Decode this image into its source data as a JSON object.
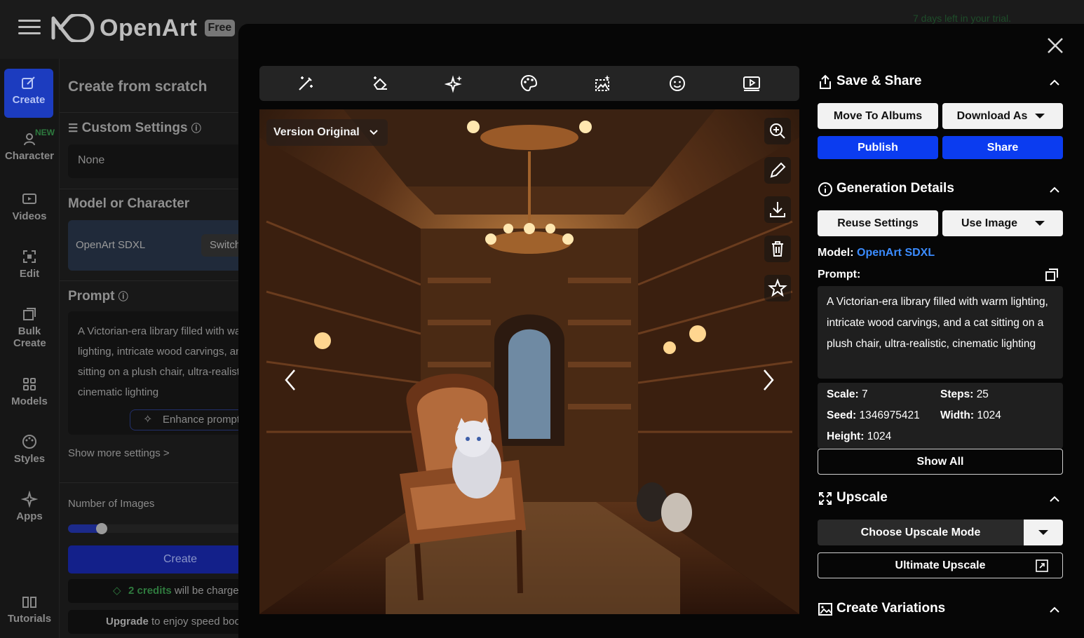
{
  "app": {
    "logo_text": "OpenArt",
    "plan_badge": "Free",
    "trial_notice": "7 days left in your trial."
  },
  "nav": {
    "items": [
      {
        "label": "Create",
        "icon": "magic-edit-icon",
        "active": true
      },
      {
        "label": "Character",
        "icon": "character-icon",
        "badge": "NEW"
      },
      {
        "label": "Videos",
        "icon": "video-icon"
      },
      {
        "label": "Edit",
        "icon": "edit-frame-icon"
      },
      {
        "label": "Bulk Create",
        "icon": "stack-icon"
      },
      {
        "label": "Models",
        "icon": "grid-icon"
      },
      {
        "label": "Styles",
        "icon": "palette-icon"
      },
      {
        "label": "Apps",
        "icon": "sparkle-icon"
      },
      {
        "label": "Tutorials",
        "icon": "book-icon"
      }
    ]
  },
  "create_panel": {
    "title": "Create from scratch",
    "custom_settings_label": "Custom Settings",
    "custom_settings_value": "None",
    "model_section_label": "Model or Character",
    "model_name": "OpenArt SDXL",
    "switch_label": "Switch",
    "prompt_label": "Prompt",
    "prompt_text": "A Victorian-era library filled with warm lighting, intricate wood carvings, and a cat sitting on a plush chair, ultra-realistic, cinematic lighting",
    "enhance_label": "Enhance prompt",
    "show_more": "Show more settings >",
    "num_images_label": "Number of Images",
    "num_images_value": 1,
    "create_button": "Create",
    "credits_amount": "2 credits",
    "credits_suffix": "will be charged",
    "upgrade_bold": "Upgrade",
    "upgrade_rest": "to enjoy speed boost"
  },
  "modal": {
    "toolbar_icons": [
      "magic-wand-icon",
      "eraser-icon",
      "sparkles-icon",
      "palette-icon",
      "image-enhance-icon",
      "face-icon",
      "video-play-icon"
    ],
    "version_label": "Version Original",
    "image_side_tools": [
      "zoom-in-icon",
      "pencil-icon",
      "download-icon",
      "trash-icon",
      "star-icon"
    ],
    "save_share": {
      "title": "Save & Share",
      "move_to_albums": "Move To Albums",
      "download_as": "Download As",
      "publish": "Publish",
      "share": "Share"
    },
    "generation": {
      "title": "Generation Details",
      "reuse_settings": "Reuse Settings",
      "use_image": "Use Image",
      "model_label": "Model:",
      "model_value": "OpenArt SDXL",
      "prompt_label": "Prompt:",
      "prompt_text": "A Victorian-era library filled with warm lighting, intricate wood carvings, and a cat sitting on a plush chair, ultra-realistic, cinematic lighting",
      "params": {
        "scale_label": "Scale:",
        "scale": "7",
        "steps_label": "Steps:",
        "steps": "25",
        "seed_label": "Seed:",
        "seed": "1346975421",
        "width_label": "Width:",
        "width": "1024",
        "height_label": "Height:",
        "height": "1024"
      },
      "show_all": "Show All"
    },
    "upscale": {
      "title": "Upscale",
      "choose_mode": "Choose Upscale Mode",
      "ultimate": "Ultimate Upscale"
    },
    "variations": {
      "title": "Create Variations"
    }
  }
}
